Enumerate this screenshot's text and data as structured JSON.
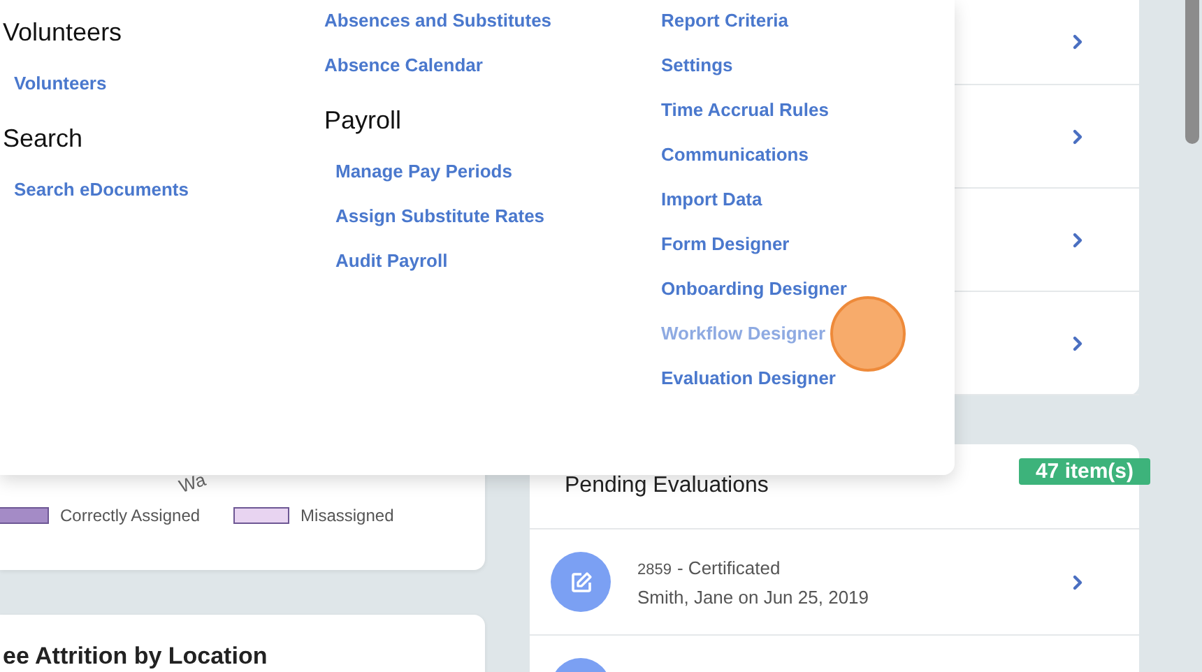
{
  "menu": {
    "columns": [
      {
        "sections": [
          {
            "heading": "Volunteers",
            "links": [
              {
                "label": "Volunteers",
                "hovered": false
              }
            ]
          },
          {
            "heading": "Search",
            "links": [
              {
                "label": "Search eDocuments",
                "hovered": false
              }
            ]
          }
        ]
      },
      {
        "sections": [
          {
            "links": [
              {
                "label": "Absences and Substitutes",
                "hovered": false
              },
              {
                "label": "Absence Calendar",
                "hovered": false
              }
            ]
          },
          {
            "heading": "Payroll",
            "links": [
              {
                "label": "Manage Pay Periods",
                "hovered": false
              },
              {
                "label": "Assign Substitute Rates",
                "hovered": false
              },
              {
                "label": "Audit Payroll",
                "hovered": false
              }
            ]
          }
        ]
      },
      {
        "sections": [
          {
            "links": [
              {
                "label": "Report Criteria",
                "hovered": false
              },
              {
                "label": "Settings",
                "hovered": false
              },
              {
                "label": "Time Accrual Rules",
                "hovered": false
              },
              {
                "label": "Communications",
                "hovered": false
              },
              {
                "label": "Import Data",
                "hovered": false
              },
              {
                "label": "Form Designer",
                "hovered": false
              },
              {
                "label": "Onboarding Designer",
                "hovered": false
              },
              {
                "label": "Workflow Designer",
                "hovered": true
              },
              {
                "label": "Evaluation Designer",
                "hovered": false
              }
            ]
          }
        ]
      }
    ]
  },
  "chart_card": {
    "axis_label": "Wa",
    "legend": [
      {
        "label": "Correctly Assigned",
        "color": "#a48bc6"
      },
      {
        "label": "Misassigned",
        "color": "#e8d4f1"
      }
    ]
  },
  "attrition_card": {
    "title": "ee Attrition by Location"
  },
  "pending": {
    "title": "Pending Evaluations",
    "badge": "47 item(s)",
    "items": [
      {
        "number": "2859",
        "category": "- Certificated",
        "detail": "Smith, Jane on Jun 25, 2019"
      }
    ]
  }
}
